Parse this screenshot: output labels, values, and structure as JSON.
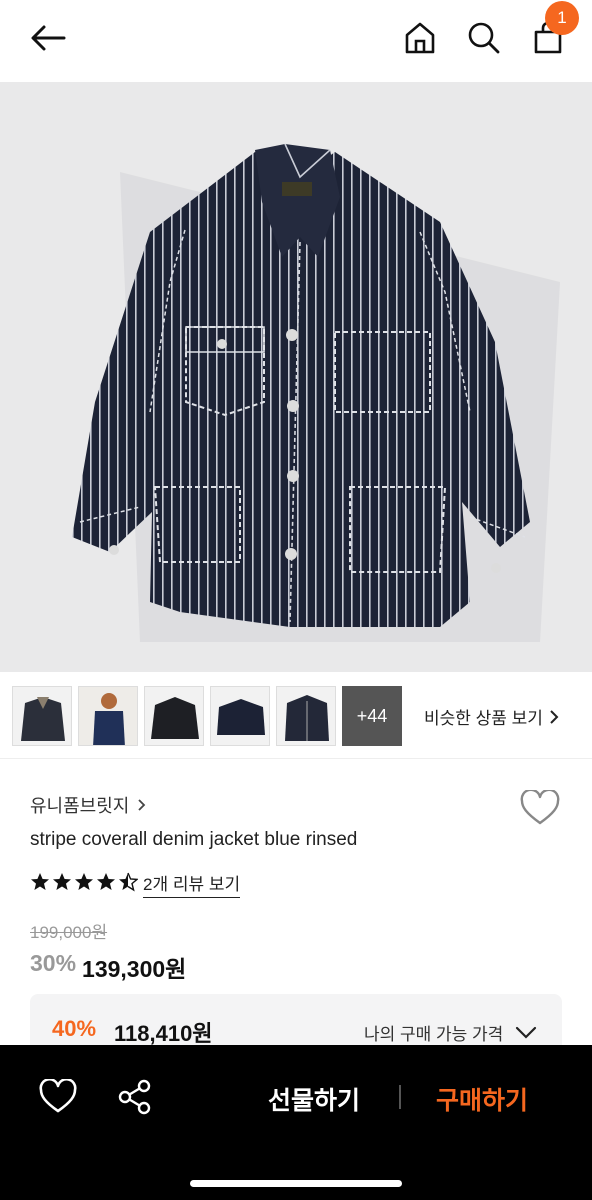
{
  "header": {
    "cart_count": "1"
  },
  "thumbnails": {
    "more_label": "+44",
    "similar_label": "비슷한 상품 보기"
  },
  "product": {
    "brand": "유니폼브릿지",
    "title": "stripe coverall denim jacket blue rinsed",
    "rating": 4.5,
    "review_link": "2개 리뷰 보기",
    "original_price": "199,000원",
    "discount": "30%",
    "sale_price": "139,300원"
  },
  "my_price": {
    "discount": "40%",
    "price": "118,410원",
    "label": "나의 구매 가능 가격"
  },
  "bottom_bar": {
    "gift_label": "선물하기",
    "buy_label": "구매하기"
  },
  "colors": {
    "accent": "#f5671f",
    "bottom_bar_bg": "#000000"
  }
}
